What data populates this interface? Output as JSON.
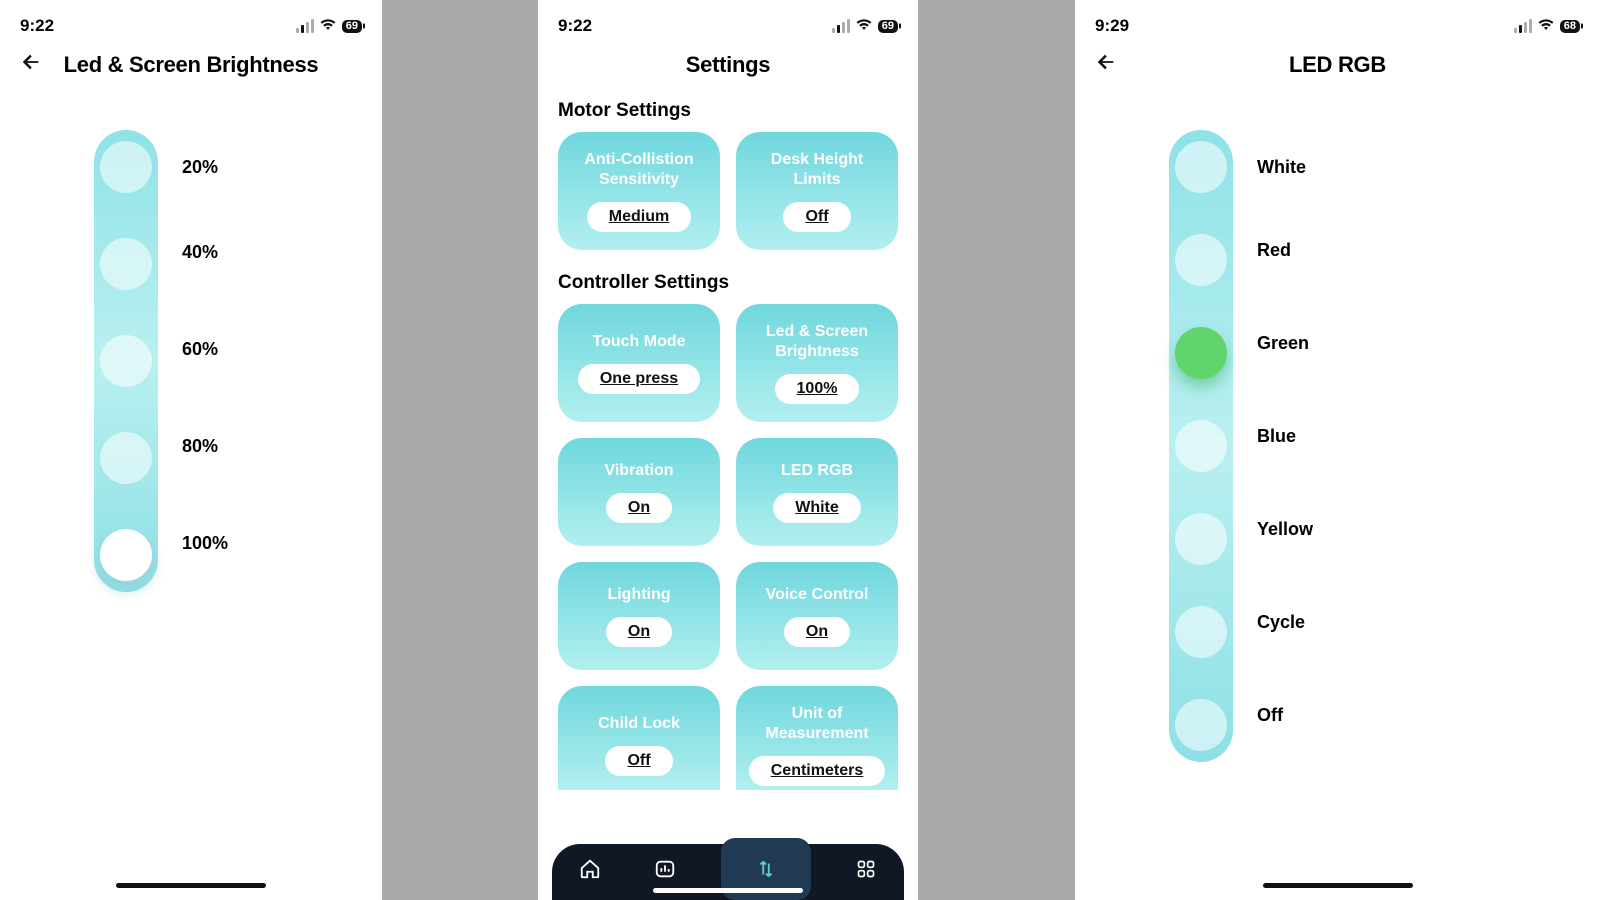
{
  "phone1": {
    "time": "9:22",
    "battery": "69",
    "title": "Led & Screen Brightness",
    "options": [
      "20%",
      "40%",
      "60%",
      "80%",
      "100%"
    ],
    "selected_index": 4
  },
  "phone2": {
    "time": "9:22",
    "battery": "69",
    "title": "Settings",
    "section1_title": "Motor Settings",
    "section1_cards": [
      {
        "title": "Anti-Collistion Sensitivity",
        "value": "Medium"
      },
      {
        "title": "Desk Height Limits",
        "value": "Off"
      }
    ],
    "section2_title": "Controller Settings",
    "section2_cards": [
      {
        "title": "Touch Mode",
        "value": "One press"
      },
      {
        "title": "Led & Screen Brightness",
        "value": "100%"
      },
      {
        "title": "Vibration",
        "value": "On"
      },
      {
        "title": "LED RGB",
        "value": "White"
      },
      {
        "title": "Lighting",
        "value": "On"
      },
      {
        "title": "Voice Control",
        "value": "On"
      },
      {
        "title": "Child Lock",
        "value": "Off"
      },
      {
        "title": "Unit of Measurement",
        "value": "Centimeters"
      }
    ]
  },
  "phone3": {
    "time": "9:29",
    "battery": "68",
    "title": "LED RGB",
    "options": [
      "White",
      "Red",
      "Green",
      "Blue",
      "Yellow",
      "Cycle",
      "Off"
    ],
    "selected_index": 2
  }
}
